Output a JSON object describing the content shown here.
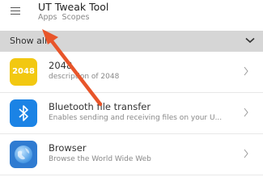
{
  "header": {
    "title": "UT Tweak Tool",
    "tabs": [
      "Apps",
      "Scopes"
    ],
    "menu_icon": "hamburger-menu-icon"
  },
  "filter": {
    "label": "Show all",
    "icon": "chevron-down-icon"
  },
  "apps": [
    {
      "title": "2048",
      "description": "description of 2048",
      "icon": "2048-app-icon",
      "icon_text": "2048",
      "icon_color": "#f2c811"
    },
    {
      "title": "Bluetooth file transfer",
      "description": "Enables sending and receiving files on your U...",
      "icon": "bluetooth-icon",
      "icon_color": "#1b83e5"
    },
    {
      "title": "Browser",
      "description": "Browse the World Wide Web",
      "icon": "browser-globe-icon",
      "icon_color": "#2f7bd1"
    }
  ],
  "annotation": {
    "color": "#e8552a",
    "icon": "pointer-arrow"
  }
}
